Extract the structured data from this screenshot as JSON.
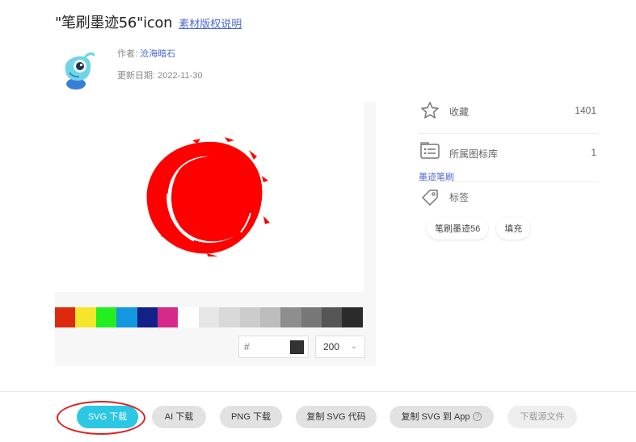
{
  "header": {
    "title": "\"笔刷墨迹56\"icon",
    "license_link": "素材版权说明"
  },
  "author": {
    "label": "作者:",
    "name": "沧海暗石",
    "date_label": "更新日期:",
    "date": "2022-11-30"
  },
  "palette": {
    "swatches": [
      "#dd2a0e",
      "#f5e62a",
      "#22ee22",
      "#1496e0",
      "#13208a",
      "#d52a8a",
      "#ffffff",
      "#e6e6e6",
      "#d9d9d9",
      "#cccccc",
      "#bdbdbd",
      "#8e8e8e",
      "#777777",
      "#555555",
      "#2b2b2b"
    ],
    "hex_prefix": "#",
    "hex_value": "",
    "current_color": "#333333",
    "size_value": "200"
  },
  "icon_preview": {
    "fill_color": "#ff0000",
    "icon": "ink-brush-circle-icon"
  },
  "sidebar": {
    "favorites_label": "收藏",
    "favorites_count": "1401",
    "library_label": "所属图标库",
    "library_count": "1",
    "library_link": "墨迹笔刷",
    "tags_label": "标签",
    "tags": [
      "笔刷墨迹56",
      "填充"
    ]
  },
  "actions": {
    "svg_download": "SVG 下载",
    "ai_download": "AI 下载",
    "png_download": "PNG 下载",
    "copy_svg_code": "复制 SVG 代码",
    "copy_svg_to_app": "复制 SVG 到 App",
    "help_glyph": "?",
    "download_source": "下载源文件"
  }
}
